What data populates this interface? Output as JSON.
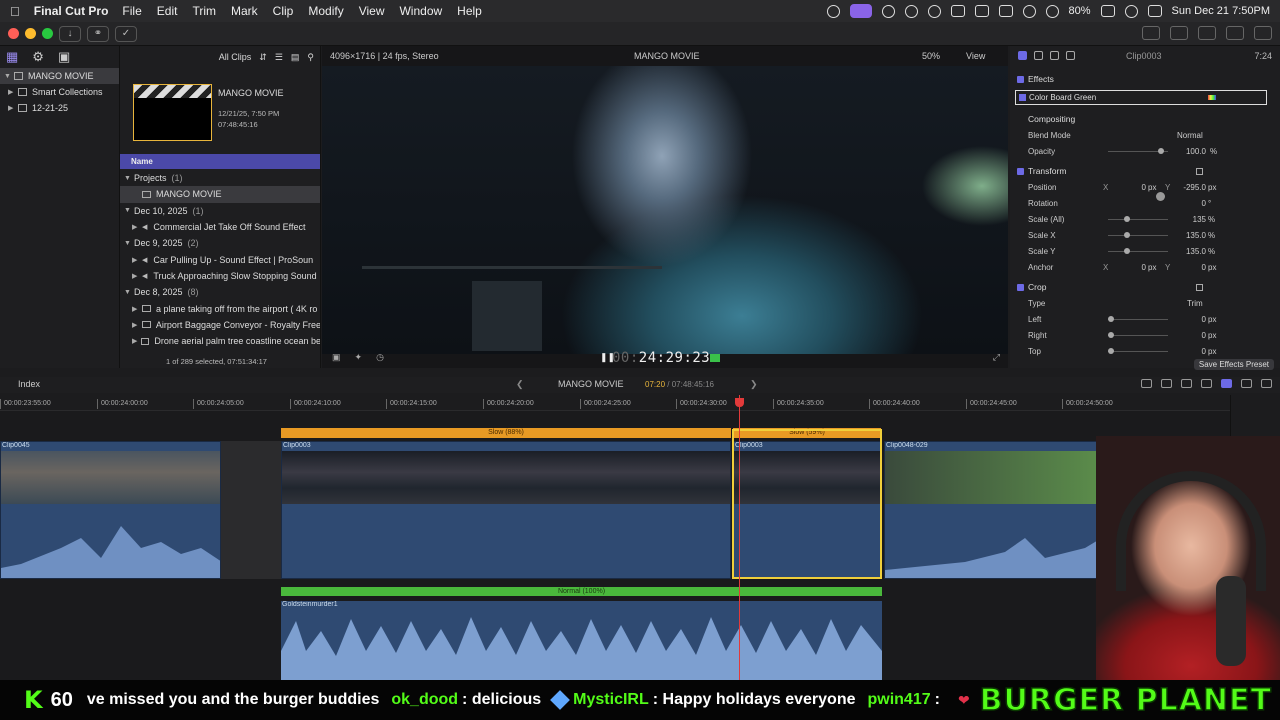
{
  "menubar": {
    "app_name": "Final Cut Pro",
    "menus": [
      "File",
      "Edit",
      "Trim",
      "Mark",
      "Clip",
      "Modify",
      "View",
      "Window",
      "Help"
    ],
    "battery": "80%",
    "datetime": "Sun Dec 21  7:50PM"
  },
  "library": {
    "items": [
      {
        "label": "MANGO MOVIE",
        "selected": true
      },
      {
        "label": "Smart Collections",
        "selected": false
      },
      {
        "label": "12-21-25",
        "selected": false
      }
    ]
  },
  "browser": {
    "filter": "All Clips",
    "project_thumb": {
      "title": "MANGO MOVIE",
      "date": "12/21/25, 7:50 PM",
      "duration": "07:48:45:16"
    },
    "column_header": "Name",
    "groups": [
      {
        "label": "Projects",
        "count": "(1)",
        "items": [
          "MANGO MOVIE"
        ]
      },
      {
        "label": "Dec 10, 2025",
        "count": "(1)",
        "items": [
          "Commercial Jet Take Off Sound Effect"
        ]
      },
      {
        "label": "Dec 9, 2025",
        "count": "(2)",
        "items": [
          "Car Pulling Up - Sound Effect  |  ProSoun",
          "Truck Approaching Slow Stopping Sound"
        ]
      },
      {
        "label": "Dec 8, 2025",
        "count": "(8)",
        "items": [
          "a plane taking off from the airport ( 4K ro",
          "Airport Baggage Conveyor - Royalty Free",
          "Drone aerial palm tree coastline ocean be"
        ]
      }
    ],
    "footer": "1 of 289 selected, 07:51:34:17"
  },
  "viewer": {
    "format": "4096×1716 | 24 fps, Stereo",
    "title": "MANGO MOVIE",
    "zoom": "50%",
    "view_label": "View",
    "timecode": "24:29:23",
    "timecode_prefix": "00:"
  },
  "inspector": {
    "clip_name": "Clip0003",
    "duration": "7:24",
    "effects_label": "Effects",
    "effect_name": "Color Board Green",
    "compositing": {
      "label": "Compositing",
      "blend_mode_label": "Blend Mode",
      "blend_mode": "Normal",
      "opacity_label": "Opacity",
      "opacity": "100.0",
      "opacity_unit": "%"
    },
    "transform": {
      "label": "Transform",
      "position_label": "Position",
      "position_x": "0",
      "position_y": "-295.0",
      "unit_px": "px",
      "rotation_label": "Rotation",
      "rotation": "0",
      "rotation_unit": "°",
      "scale_all_label": "Scale (All)",
      "scale_all": "135",
      "scale_x_label": "Scale X",
      "scale_x": "135.0",
      "scale_y_label": "Scale Y",
      "scale_y": "135.0",
      "percent": "%",
      "anchor_label": "Anchor",
      "anchor_x": "0",
      "anchor_y": "0"
    },
    "crop": {
      "label": "Crop",
      "type_label": "Type",
      "type": "Trim",
      "left_label": "Left",
      "left": "0",
      "right_label": "Right",
      "right": "0",
      "top_label": "Top",
      "top": "0"
    },
    "x_label": "X",
    "y_label": "Y",
    "save_preset": "Save Effects Preset"
  },
  "timeline": {
    "index_label": "Index",
    "project": "MANGO MOVIE",
    "tc_position": "07:20",
    "tc_total": "07:48:45:16",
    "ruler": [
      "00:00:23:55:00",
      "00:00:24:00:00",
      "00:00:24:05:00",
      "00:00:24:10:00",
      "00:00:24:15:00",
      "00:00:24:20:00",
      "00:00:24:25:00",
      "00:00:24:30:00",
      "00:00:24:35:00",
      "00:00:24:40:00",
      "00:00:24:45:00",
      "00:00:24:50:00"
    ],
    "clips": [
      {
        "name": "Clip0045"
      },
      {
        "name": "Clip0003",
        "retime": "Slow (88%)"
      },
      {
        "name": "Clip0003",
        "retime": "Slow (59%)"
      },
      {
        "name": "Clip0048-029"
      }
    ],
    "audio_clip": {
      "name": "Goldsteinmurder1",
      "retime": "Normal (100%)"
    }
  },
  "chat": {
    "viewers": "60",
    "messages": [
      {
        "user": "",
        "text": "ve missed you and the burger buddies"
      },
      {
        "user": "ok_dood",
        "text": ": delicious"
      },
      {
        "user": "MysticIRL",
        "text": ": Happy holidays everyone"
      },
      {
        "user": "pwin417",
        "text": ":"
      }
    ],
    "brand": "BURGER PLANET"
  }
}
